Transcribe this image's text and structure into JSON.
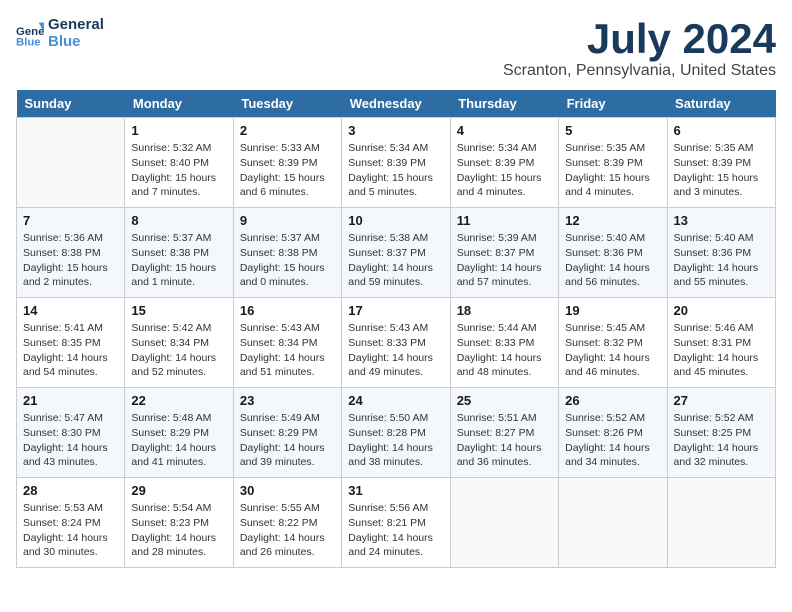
{
  "header": {
    "logo_line1": "General",
    "logo_line2": "Blue",
    "month_title": "July 2024",
    "location": "Scranton, Pennsylvania, United States"
  },
  "weekdays": [
    "Sunday",
    "Monday",
    "Tuesday",
    "Wednesday",
    "Thursday",
    "Friday",
    "Saturday"
  ],
  "weeks": [
    [
      {
        "day": "",
        "sunrise": "",
        "sunset": "",
        "daylight": ""
      },
      {
        "day": "1",
        "sunrise": "Sunrise: 5:32 AM",
        "sunset": "Sunset: 8:40 PM",
        "daylight": "Daylight: 15 hours and 7 minutes."
      },
      {
        "day": "2",
        "sunrise": "Sunrise: 5:33 AM",
        "sunset": "Sunset: 8:39 PM",
        "daylight": "Daylight: 15 hours and 6 minutes."
      },
      {
        "day": "3",
        "sunrise": "Sunrise: 5:34 AM",
        "sunset": "Sunset: 8:39 PM",
        "daylight": "Daylight: 15 hours and 5 minutes."
      },
      {
        "day": "4",
        "sunrise": "Sunrise: 5:34 AM",
        "sunset": "Sunset: 8:39 PM",
        "daylight": "Daylight: 15 hours and 4 minutes."
      },
      {
        "day": "5",
        "sunrise": "Sunrise: 5:35 AM",
        "sunset": "Sunset: 8:39 PM",
        "daylight": "Daylight: 15 hours and 4 minutes."
      },
      {
        "day": "6",
        "sunrise": "Sunrise: 5:35 AM",
        "sunset": "Sunset: 8:39 PM",
        "daylight": "Daylight: 15 hours and 3 minutes."
      }
    ],
    [
      {
        "day": "7",
        "sunrise": "Sunrise: 5:36 AM",
        "sunset": "Sunset: 8:38 PM",
        "daylight": "Daylight: 15 hours and 2 minutes."
      },
      {
        "day": "8",
        "sunrise": "Sunrise: 5:37 AM",
        "sunset": "Sunset: 8:38 PM",
        "daylight": "Daylight: 15 hours and 1 minute."
      },
      {
        "day": "9",
        "sunrise": "Sunrise: 5:37 AM",
        "sunset": "Sunset: 8:38 PM",
        "daylight": "Daylight: 15 hours and 0 minutes."
      },
      {
        "day": "10",
        "sunrise": "Sunrise: 5:38 AM",
        "sunset": "Sunset: 8:37 PM",
        "daylight": "Daylight: 14 hours and 59 minutes."
      },
      {
        "day": "11",
        "sunrise": "Sunrise: 5:39 AM",
        "sunset": "Sunset: 8:37 PM",
        "daylight": "Daylight: 14 hours and 57 minutes."
      },
      {
        "day": "12",
        "sunrise": "Sunrise: 5:40 AM",
        "sunset": "Sunset: 8:36 PM",
        "daylight": "Daylight: 14 hours and 56 minutes."
      },
      {
        "day": "13",
        "sunrise": "Sunrise: 5:40 AM",
        "sunset": "Sunset: 8:36 PM",
        "daylight": "Daylight: 14 hours and 55 minutes."
      }
    ],
    [
      {
        "day": "14",
        "sunrise": "Sunrise: 5:41 AM",
        "sunset": "Sunset: 8:35 PM",
        "daylight": "Daylight: 14 hours and 54 minutes."
      },
      {
        "day": "15",
        "sunrise": "Sunrise: 5:42 AM",
        "sunset": "Sunset: 8:34 PM",
        "daylight": "Daylight: 14 hours and 52 minutes."
      },
      {
        "day": "16",
        "sunrise": "Sunrise: 5:43 AM",
        "sunset": "Sunset: 8:34 PM",
        "daylight": "Daylight: 14 hours and 51 minutes."
      },
      {
        "day": "17",
        "sunrise": "Sunrise: 5:43 AM",
        "sunset": "Sunset: 8:33 PM",
        "daylight": "Daylight: 14 hours and 49 minutes."
      },
      {
        "day": "18",
        "sunrise": "Sunrise: 5:44 AM",
        "sunset": "Sunset: 8:33 PM",
        "daylight": "Daylight: 14 hours and 48 minutes."
      },
      {
        "day": "19",
        "sunrise": "Sunrise: 5:45 AM",
        "sunset": "Sunset: 8:32 PM",
        "daylight": "Daylight: 14 hours and 46 minutes."
      },
      {
        "day": "20",
        "sunrise": "Sunrise: 5:46 AM",
        "sunset": "Sunset: 8:31 PM",
        "daylight": "Daylight: 14 hours and 45 minutes."
      }
    ],
    [
      {
        "day": "21",
        "sunrise": "Sunrise: 5:47 AM",
        "sunset": "Sunset: 8:30 PM",
        "daylight": "Daylight: 14 hours and 43 minutes."
      },
      {
        "day": "22",
        "sunrise": "Sunrise: 5:48 AM",
        "sunset": "Sunset: 8:29 PM",
        "daylight": "Daylight: 14 hours and 41 minutes."
      },
      {
        "day": "23",
        "sunrise": "Sunrise: 5:49 AM",
        "sunset": "Sunset: 8:29 PM",
        "daylight": "Daylight: 14 hours and 39 minutes."
      },
      {
        "day": "24",
        "sunrise": "Sunrise: 5:50 AM",
        "sunset": "Sunset: 8:28 PM",
        "daylight": "Daylight: 14 hours and 38 minutes."
      },
      {
        "day": "25",
        "sunrise": "Sunrise: 5:51 AM",
        "sunset": "Sunset: 8:27 PM",
        "daylight": "Daylight: 14 hours and 36 minutes."
      },
      {
        "day": "26",
        "sunrise": "Sunrise: 5:52 AM",
        "sunset": "Sunset: 8:26 PM",
        "daylight": "Daylight: 14 hours and 34 minutes."
      },
      {
        "day": "27",
        "sunrise": "Sunrise: 5:52 AM",
        "sunset": "Sunset: 8:25 PM",
        "daylight": "Daylight: 14 hours and 32 minutes."
      }
    ],
    [
      {
        "day": "28",
        "sunrise": "Sunrise: 5:53 AM",
        "sunset": "Sunset: 8:24 PM",
        "daylight": "Daylight: 14 hours and 30 minutes."
      },
      {
        "day": "29",
        "sunrise": "Sunrise: 5:54 AM",
        "sunset": "Sunset: 8:23 PM",
        "daylight": "Daylight: 14 hours and 28 minutes."
      },
      {
        "day": "30",
        "sunrise": "Sunrise: 5:55 AM",
        "sunset": "Sunset: 8:22 PM",
        "daylight": "Daylight: 14 hours and 26 minutes."
      },
      {
        "day": "31",
        "sunrise": "Sunrise: 5:56 AM",
        "sunset": "Sunset: 8:21 PM",
        "daylight": "Daylight: 14 hours and 24 minutes."
      },
      {
        "day": "",
        "sunrise": "",
        "sunset": "",
        "daylight": ""
      },
      {
        "day": "",
        "sunrise": "",
        "sunset": "",
        "daylight": ""
      },
      {
        "day": "",
        "sunrise": "",
        "sunset": "",
        "daylight": ""
      }
    ]
  ]
}
